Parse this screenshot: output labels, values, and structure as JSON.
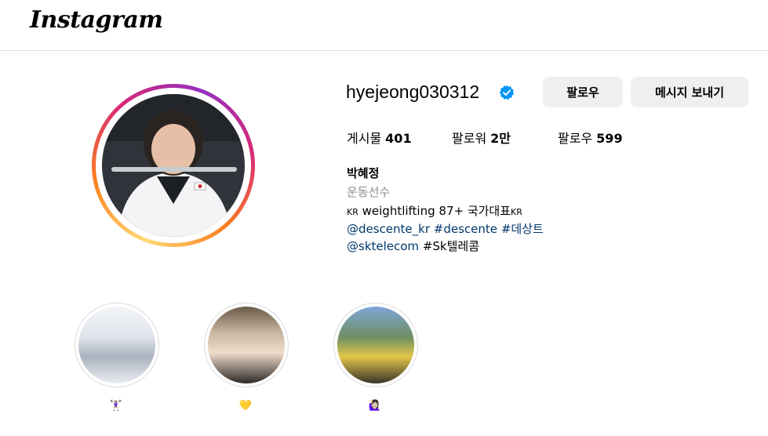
{
  "app": {
    "logo_text": "Instagram"
  },
  "profile": {
    "username": "hyejeong030312",
    "verified": true,
    "buttons": {
      "follow_label": "팔로우",
      "message_label": "메시지 보내기"
    },
    "stats": {
      "posts_label": "게시물",
      "posts_value": "401",
      "followers_label": "팔로워",
      "followers_value": "2만",
      "following_label": "팔로우",
      "following_value": "599"
    },
    "bio": {
      "name": "박혜정",
      "category": "운동선수",
      "line1_flag_a": "KR",
      "line1_text": " weightlifting 87+ 국가대표",
      "line1_flag_b": "KR",
      "line2_mention": "@descente_kr",
      "line2_tag1": "#descente",
      "line2_tag2": "#데상트",
      "line3_mention": "@sktelecom",
      "line3_tag": "#Sk텔레콤"
    }
  },
  "highlights": [
    {
      "title": "🏋🏻‍♀️"
    },
    {
      "title": "💛"
    },
    {
      "title": "🙋🏻‍♀️"
    }
  ],
  "colors": {
    "link": "#00376b",
    "verified": "#0095f6",
    "button_bg": "#efefef",
    "secondary_text": "#8e8e8e"
  }
}
